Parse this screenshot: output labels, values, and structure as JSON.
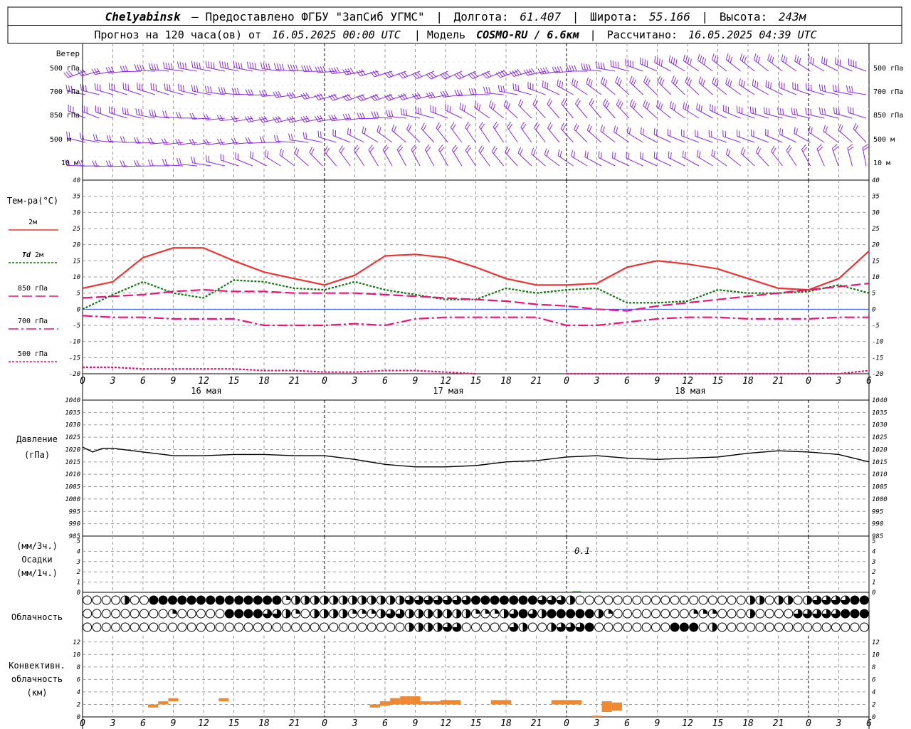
{
  "header": {
    "station": "Chelyabinsk",
    "provider": "— Предоставлено ФГБУ \"ЗапСиб УГМС\"",
    "lon_label": "Долгота:",
    "lon": "61.407",
    "lat_label": "Широта:",
    "lat": "55.166",
    "alt_label": "Высота:",
    "alt": "243м",
    "forecast_label": "Прогноз на 120 часа(ов) от",
    "forecast_start": "16.05.2025 00:00 UTC",
    "model_label": "Модель",
    "model": "COSMO-RU / 6.6км",
    "calc_label": "Рассчитано:",
    "calc_time": "16.05.2025 04:39 UTC"
  },
  "labels": {
    "wind": "Ветер",
    "levels": [
      "500 гПа",
      "700 гПа",
      "850 гПа",
      "500 м",
      "10 м"
    ],
    "temp_title": "Тем-ра(°С)",
    "t2m": "2м",
    "td_a": "Td",
    "td_b": "2м",
    "t850": "850 гПа",
    "t700": "700 гПа",
    "t500": "500 гПа",
    "pressure_a": "Давление",
    "pressure_b": "(гПа)",
    "precip_a": "(мм/3ч.)",
    "precip_b": "Осадки",
    "precip_c": "(мм/1ч.)",
    "cloud": "Облачность",
    "conv_a": "Конвективн.",
    "conv_b": "облачность",
    "conv_c": "(км)",
    "precip_value": "0.1"
  },
  "colors": {
    "t2m": "#ee3333",
    "td": "#117711",
    "upper": "#e8157a",
    "wind": "#8a2be2",
    "pressure": "#000000",
    "conv": "#ee8833",
    "grid": "#999999",
    "zero": "#3355ff"
  },
  "chart_data": [
    {
      "type": "line",
      "title": "Тем-ра(°С)",
      "x_hours_label": "hours since 16.05.2025 00:00 UTC",
      "x_ticks": [
        "0",
        "3",
        "6",
        "9",
        "12",
        "15",
        "18",
        "21",
        "0",
        "3",
        "6",
        "9",
        "12",
        "15",
        "18",
        "21",
        "0",
        "3",
        "6",
        "9",
        "12",
        "15",
        "18",
        "21",
        "0",
        "3",
        "6"
      ],
      "day_labels": [
        "16 мая",
        "17 мая",
        "18 мая"
      ],
      "ylim": [
        -20,
        40
      ],
      "y_ticks": [
        -20,
        -15,
        -10,
        -5,
        0,
        5,
        10,
        15,
        20,
        25,
        30,
        35,
        40
      ],
      "series": [
        {
          "name": "2м",
          "x": [
            0,
            3,
            6,
            9,
            12,
            15,
            18,
            21,
            24,
            27,
            30,
            33,
            36,
            39,
            42,
            45,
            48,
            51,
            54,
            57,
            60,
            63,
            66,
            69,
            72,
            75,
            78
          ],
          "values": [
            6.5,
            8.5,
            16,
            19,
            19,
            15,
            11.5,
            9.5,
            7.5,
            10.5,
            16.5,
            17,
            16,
            13,
            9.5,
            7.5,
            7.5,
            8,
            13,
            15,
            14,
            12.5,
            9.5,
            6.5,
            6,
            9.5,
            18
          ]
        },
        {
          "name": "Td 2м",
          "x": [
            0,
            3,
            6,
            9,
            12,
            15,
            18,
            21,
            24,
            27,
            30,
            33,
            36,
            39,
            42,
            45,
            48,
            51,
            54,
            57,
            60,
            63,
            66,
            69,
            72,
            75,
            78
          ],
          "values": [
            0,
            4.5,
            8.5,
            5,
            3.5,
            9,
            8.5,
            6.5,
            6,
            8.5,
            6,
            4.5,
            3,
            3,
            6.5,
            5,
            6,
            6.5,
            2,
            2,
            2.5,
            6,
            5,
            5,
            5.5,
            7.5,
            5
          ]
        },
        {
          "name": "850 гПа",
          "x": [
            0,
            3,
            6,
            9,
            12,
            15,
            18,
            21,
            24,
            27,
            30,
            33,
            36,
            39,
            42,
            45,
            48,
            51,
            54,
            57,
            60,
            63,
            66,
            69,
            72,
            75,
            78
          ],
          "values": [
            3.5,
            4,
            4.5,
            5.5,
            6,
            5.5,
            5.5,
            5,
            5,
            5,
            4.5,
            4,
            3.5,
            3,
            2.5,
            1.5,
            1,
            0,
            -0.5,
            1,
            2,
            3,
            4,
            5,
            6,
            7,
            8
          ]
        },
        {
          "name": "700 гПа",
          "x": [
            0,
            3,
            6,
            9,
            12,
            15,
            18,
            21,
            24,
            27,
            30,
            33,
            36,
            39,
            42,
            45,
            48,
            51,
            54,
            57,
            60,
            63,
            66,
            69,
            72,
            75,
            78
          ],
          "values": [
            -2,
            -2.5,
            -2.5,
            -3,
            -3,
            -3,
            -5,
            -5,
            -5,
            -4.5,
            -5,
            -3,
            -2.5,
            -2.5,
            -2.5,
            -2.5,
            -5,
            -5,
            -4,
            -3,
            -2.5,
            -2.5,
            -3,
            -3,
            -3,
            -2.5,
            -2.5
          ]
        },
        {
          "name": "500 гПа",
          "x": [
            0,
            3,
            6,
            9,
            12,
            15,
            18,
            21,
            24,
            27,
            30,
            33,
            36,
            39,
            42,
            48,
            51,
            54,
            75,
            78
          ],
          "values": [
            -18,
            -18,
            -18.5,
            -18.5,
            -18.5,
            -18.5,
            -19,
            -19,
            -19.5,
            -19.5,
            -19,
            -19,
            -19.5,
            -20,
            null,
            -20,
            -20,
            -20,
            -20,
            -19
          ]
        }
      ]
    },
    {
      "type": "line",
      "title": "Давление",
      "ylabel": "(гПа)",
      "ylim": [
        985,
        1040
      ],
      "y_ticks": [
        985,
        990,
        995,
        1000,
        1005,
        1010,
        1015,
        1020,
        1025,
        1030,
        1035,
        1040
      ],
      "x": [
        0,
        1,
        2,
        3,
        6,
        9,
        12,
        15,
        18,
        21,
        24,
        27,
        30,
        33,
        36,
        39,
        42,
        45,
        48,
        51,
        54,
        57,
        60,
        63,
        66,
        69,
        72,
        75,
        78
      ],
      "values": [
        1021,
        1019,
        1020.5,
        1020.5,
        1019,
        1017.5,
        1017.5,
        1018,
        1018,
        1017.5,
        1017.5,
        1016,
        1014,
        1013,
        1013,
        1013.5,
        1015,
        1015.5,
        1017,
        1017.5,
        1016.5,
        1016,
        1016.5,
        1017,
        1018.5,
        1019.5,
        1019,
        1018,
        1015
      ]
    },
    {
      "type": "bar",
      "title": "Осадки",
      "ylim": [
        0,
        5
      ],
      "y_ticks": [
        0,
        1,
        2,
        3,
        4,
        5
      ],
      "x": [
        49
      ],
      "values": [
        0.1
      ]
    },
    {
      "type": "table",
      "title": "Облачность",
      "cover_scale": "fraction 0..1 of circle filled",
      "rows": [
        {
          "values": [
            0,
            0,
            0,
            0,
            0.5,
            0,
            0,
            1,
            1,
            1,
            1,
            1,
            1,
            1,
            1,
            1,
            1,
            1,
            1,
            1,
            1,
            0.25,
            0.5,
            0.5,
            0.5,
            0.5,
            0.5,
            0.5,
            0.5,
            0.5,
            0.5,
            0.5,
            0.5,
            0.5,
            0.75,
            0.75,
            0.75,
            0.75,
            0.75,
            0.75,
            0.75,
            1,
            1,
            1,
            1,
            1,
            1,
            1,
            0.75,
            0.75,
            0.75,
            0.5,
            0,
            0,
            0,
            0,
            0,
            0,
            0,
            0,
            0,
            0,
            0,
            0,
            0,
            0,
            0,
            0,
            0,
            0,
            0.5,
            0.5,
            0,
            0.5,
            0.5,
            0,
            0.5,
            0.75,
            0.75,
            0.75,
            0.75,
            1,
            1
          ]
        },
        {
          "values": [
            0,
            0,
            0,
            0,
            0,
            0,
            0,
            0,
            0,
            0.25,
            0,
            0,
            0,
            0,
            0,
            1,
            1,
            1,
            1,
            0.75,
            0.75,
            0.5,
            0.25,
            0,
            0.5,
            0.5,
            0.5,
            0.5,
            0.25,
            0.25,
            0.25,
            0.5,
            0.75,
            0.75,
            0.5,
            0.5,
            0.5,
            0.5,
            0.5,
            0.5,
            0.5,
            0.25,
            0.25,
            0.25,
            0.5,
            0.75,
            1,
            0.75,
            0.5,
            1,
            1,
            1,
            1,
            1,
            0.5,
            0.25,
            0,
            0,
            0,
            0,
            0,
            0,
            0,
            0,
            0.25,
            0.25,
            0.25,
            0,
            0,
            0,
            0.5,
            0,
            0,
            0,
            0,
            0.75,
            0.75,
            0.75,
            0.75,
            0.75,
            1,
            1,
            1
          ]
        },
        {
          "values": [
            0,
            0,
            0,
            0,
            0,
            0,
            0,
            0,
            0,
            0,
            0,
            0,
            0,
            0,
            0,
            0,
            0,
            0,
            0,
            0,
            0,
            0,
            0,
            0,
            0,
            0,
            0,
            0,
            0,
            0,
            0,
            0,
            0,
            0,
            0.5,
            0.5,
            0.5,
            0.5,
            0.75,
            0.75,
            0,
            0,
            0,
            0,
            0,
            0.75,
            0.5,
            0,
            0,
            0.5,
            0.75,
            0.75,
            0.75,
            1,
            0,
            0,
            0,
            0,
            0,
            0,
            0,
            0,
            1,
            1,
            1,
            0,
            0.5,
            0,
            0,
            0,
            0,
            0,
            0,
            0,
            0,
            0,
            0,
            0,
            0,
            0,
            0,
            0,
            0
          ]
        }
      ]
    },
    {
      "type": "bar",
      "title": "Конвективн. облачность",
      "ylabel": "(км)",
      "ylim": [
        0,
        13
      ],
      "y_ticks": [
        0,
        2,
        4,
        6,
        8,
        10,
        12
      ],
      "segments_hours": [
        [
          6.5,
          7.5
        ],
        [
          7.5,
          8.5
        ],
        [
          8.5,
          9.5
        ],
        [
          13.5,
          14.5
        ],
        [
          28.5,
          29.5
        ],
        [
          29.5,
          30.5
        ],
        [
          30.5,
          31.5
        ],
        [
          31.5,
          32.5
        ],
        [
          32.5,
          33.5
        ],
        [
          33.5,
          34.5
        ],
        [
          34.5,
          35.5
        ],
        [
          35.5,
          36.5
        ],
        [
          36.5,
          37.5
        ],
        [
          40.5,
          42.5
        ],
        [
          46.5,
          49.5
        ],
        [
          50.5,
          51.5
        ],
        [
          51.5,
          52.5
        ],
        [
          52.5,
          53.5
        ]
      ],
      "bottom_km": [
        1.5,
        2,
        2.5,
        2.5,
        1.5,
        1.8,
        2,
        2,
        2,
        2,
        2,
        2,
        2,
        2,
        2,
        0,
        0.8,
        1
      ],
      "top_km": [
        2,
        2.5,
        3,
        3,
        2,
        2.5,
        3,
        3.3,
        3.3,
        2.5,
        2.5,
        2.7,
        2.7,
        2.7,
        2.7,
        0.2,
        2.5,
        2.3
      ]
    }
  ]
}
